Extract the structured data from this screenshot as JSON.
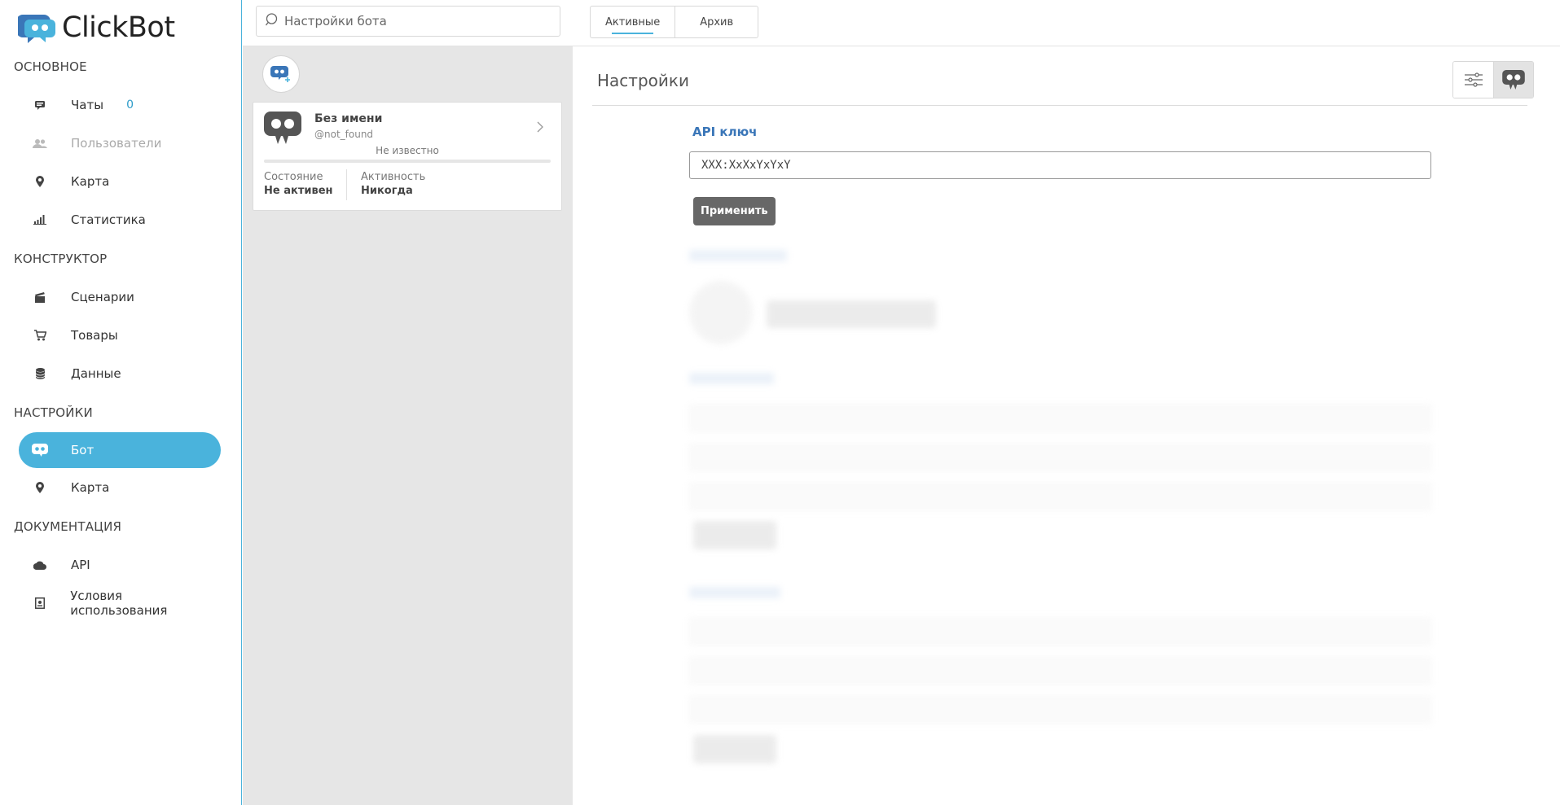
{
  "app": {
    "name": "ClickBot",
    "accent": "#4ab3dc"
  },
  "sidebar": {
    "sections": [
      {
        "title": "ОСНОВНОЕ",
        "items": [
          {
            "label": "Чаты",
            "icon": "chat-icon",
            "badge": "0"
          },
          {
            "label": "Пользователи",
            "icon": "users-icon",
            "disabled": true
          },
          {
            "label": "Карта",
            "icon": "map-pin-icon"
          },
          {
            "label": "Статистика",
            "icon": "stats-icon"
          }
        ]
      },
      {
        "title": "КОНСТРУКТОР",
        "items": [
          {
            "label": "Сценарии",
            "icon": "clapperboard-icon"
          },
          {
            "label": "Товары",
            "icon": "cart-icon"
          },
          {
            "label": "Данные",
            "icon": "database-icon"
          }
        ]
      },
      {
        "title": "НАСТРОЙКИ",
        "items": [
          {
            "label": "Бот",
            "icon": "bot-icon",
            "active": true
          },
          {
            "label": "Карта",
            "icon": "map-pin-icon"
          }
        ]
      },
      {
        "title": "ДОКУМЕНТАЦИЯ",
        "items": [
          {
            "label": "API",
            "icon": "cloud-icon"
          },
          {
            "label": "Условия использования",
            "icon": "document-icon"
          }
        ]
      }
    ]
  },
  "topbar": {
    "search_placeholder": "Настройки бота",
    "tabs": [
      {
        "label": "Активные",
        "active": true
      },
      {
        "label": "Архив"
      }
    ]
  },
  "bot_list": [
    {
      "name": "Без имени",
      "username": "@not_found",
      "status_line": "Не известно",
      "progress": 0,
      "state_label": "Состояние",
      "state_value": "Не активен",
      "activity_label": "Активность",
      "activity_value": "Никогда"
    }
  ],
  "settings": {
    "title": "Настройки",
    "api_key_label": "API ключ",
    "api_key_value": "XXX:XxXxYxYxY",
    "apply_label": "Применить"
  }
}
